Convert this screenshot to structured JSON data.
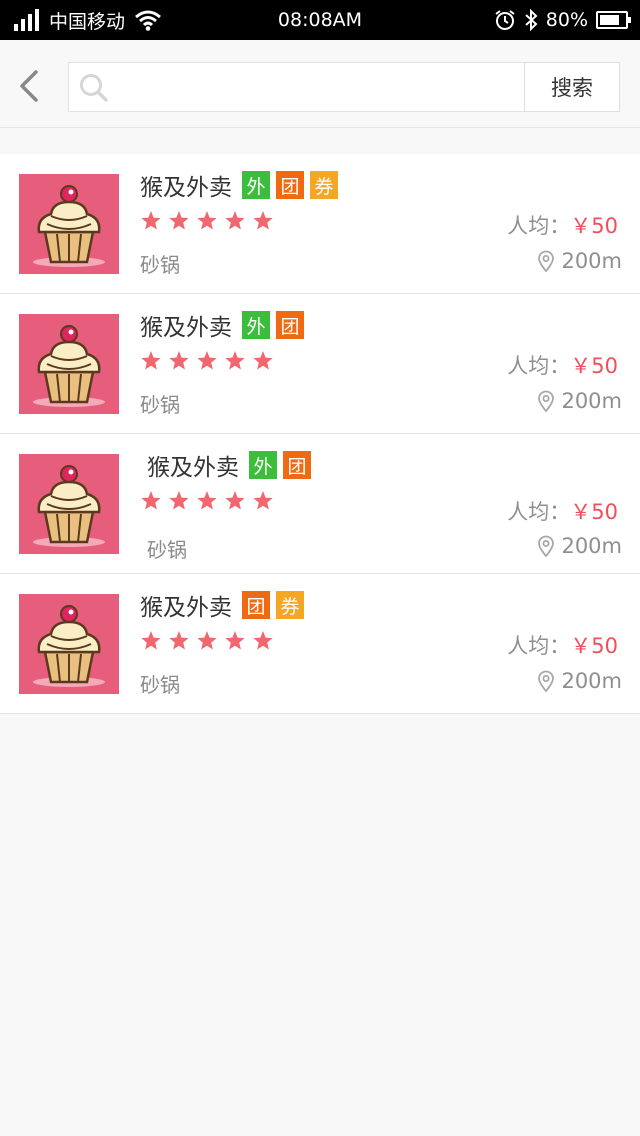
{
  "status_bar": {
    "carrier": "中国移动",
    "time": "08:08AM",
    "battery": "80%",
    "battery_level": 0.8
  },
  "search": {
    "placeholder": "",
    "value": "",
    "button_label": "搜索"
  },
  "colors": {
    "tag_wai": "#3cbe3c",
    "tag_tuan": "#f06a12",
    "tag_quan": "#f5a623",
    "price_accent": "#ee4f5a",
    "star": "#f06770",
    "thumb_bg": "#e75d7c"
  },
  "icons": {
    "back": "chevron-left-icon",
    "search": "search-icon",
    "location": "location-pin-icon",
    "star": "star-icon",
    "thumbnail": "cupcake-icon"
  },
  "restaurants": [
    {
      "name": "猴及外卖",
      "tags": [
        "外",
        "团",
        "券"
      ],
      "rating": 5,
      "category": "砂锅",
      "price_label": "人均：",
      "price": "￥50",
      "distance": "200m"
    },
    {
      "name": "猴及外卖",
      "tags": [
        "外",
        "团"
      ],
      "rating": 5,
      "category": "砂锅",
      "price_label": "人均：",
      "price": "￥50",
      "distance": "200m"
    },
    {
      "name": "猴及外卖",
      "tags": [
        "外",
        "团"
      ],
      "rating": 5,
      "category": "砂锅",
      "price_label": "人均：",
      "price": "￥50",
      "distance": "200m"
    },
    {
      "name": "猴及外卖",
      "tags": [
        "团",
        "券"
      ],
      "rating": 5,
      "category": "砂锅",
      "price_label": "人均：",
      "price": "￥50",
      "distance": "200m"
    }
  ]
}
